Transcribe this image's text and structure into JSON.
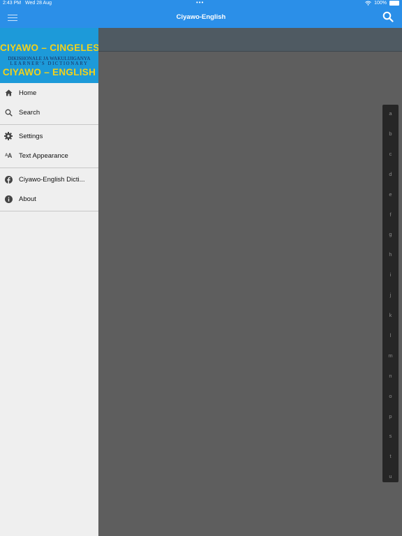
{
  "status": {
    "time": "2:43 PM",
    "date": "Wed 28 Aug",
    "battery": "100%"
  },
  "nav": {
    "title": "Ciyawo-English"
  },
  "banner": {
    "line1": "CIYAWO – CINGELESI",
    "line2": "DIKISHONALE JA WAKULIJIGANYA",
    "line3": "LEARNER'S DICTIONARY",
    "line4": "CIYAWO – ENGLISH"
  },
  "menu": {
    "group1": [
      {
        "label": "Home",
        "icon": "home-icon"
      },
      {
        "label": "Search",
        "icon": "search-icon"
      }
    ],
    "group2": [
      {
        "label": "Settings",
        "icon": "gear-icon"
      },
      {
        "label": "Text Appearance",
        "icon": "text-size-icon"
      }
    ],
    "group3": [
      {
        "label": "Ciyawo-English Dicti...",
        "icon": "facebook-icon"
      },
      {
        "label": "About",
        "icon": "info-icon"
      }
    ]
  },
  "alphabet": [
    "a",
    "b",
    "c",
    "d",
    "e",
    "f",
    "g",
    "h",
    "i",
    "j",
    "k",
    "l",
    "m",
    "n",
    "o",
    "p",
    "s",
    "t",
    "u"
  ],
  "colors": {
    "nav_blue": "#2b8fe8",
    "banner_blue": "#1d9ad9",
    "banner_yellow": "#f2d21b"
  }
}
